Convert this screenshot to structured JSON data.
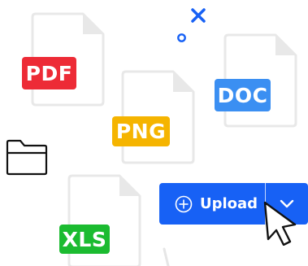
{
  "files": [
    {
      "id": "pdf",
      "label": "PDF",
      "color": "#ed2b36"
    },
    {
      "id": "png",
      "label": "PNG",
      "color": "#f5b400"
    },
    {
      "id": "doc",
      "label": "DOC",
      "color": "#3b8ff2"
    },
    {
      "id": "xls",
      "label": "XLS",
      "color": "#1bbb30"
    }
  ],
  "upload_button": {
    "label": "Upload",
    "icon": "plus-circle-icon",
    "dropdown_icon": "chevron-down-icon",
    "color": "#1761f5"
  },
  "icons": [
    "folder-icon",
    "close-icon",
    "circle-icon",
    "mouse-pointer-icon"
  ],
  "colors": {
    "accent": "#1761f5",
    "outline": "#e6e6e6"
  }
}
